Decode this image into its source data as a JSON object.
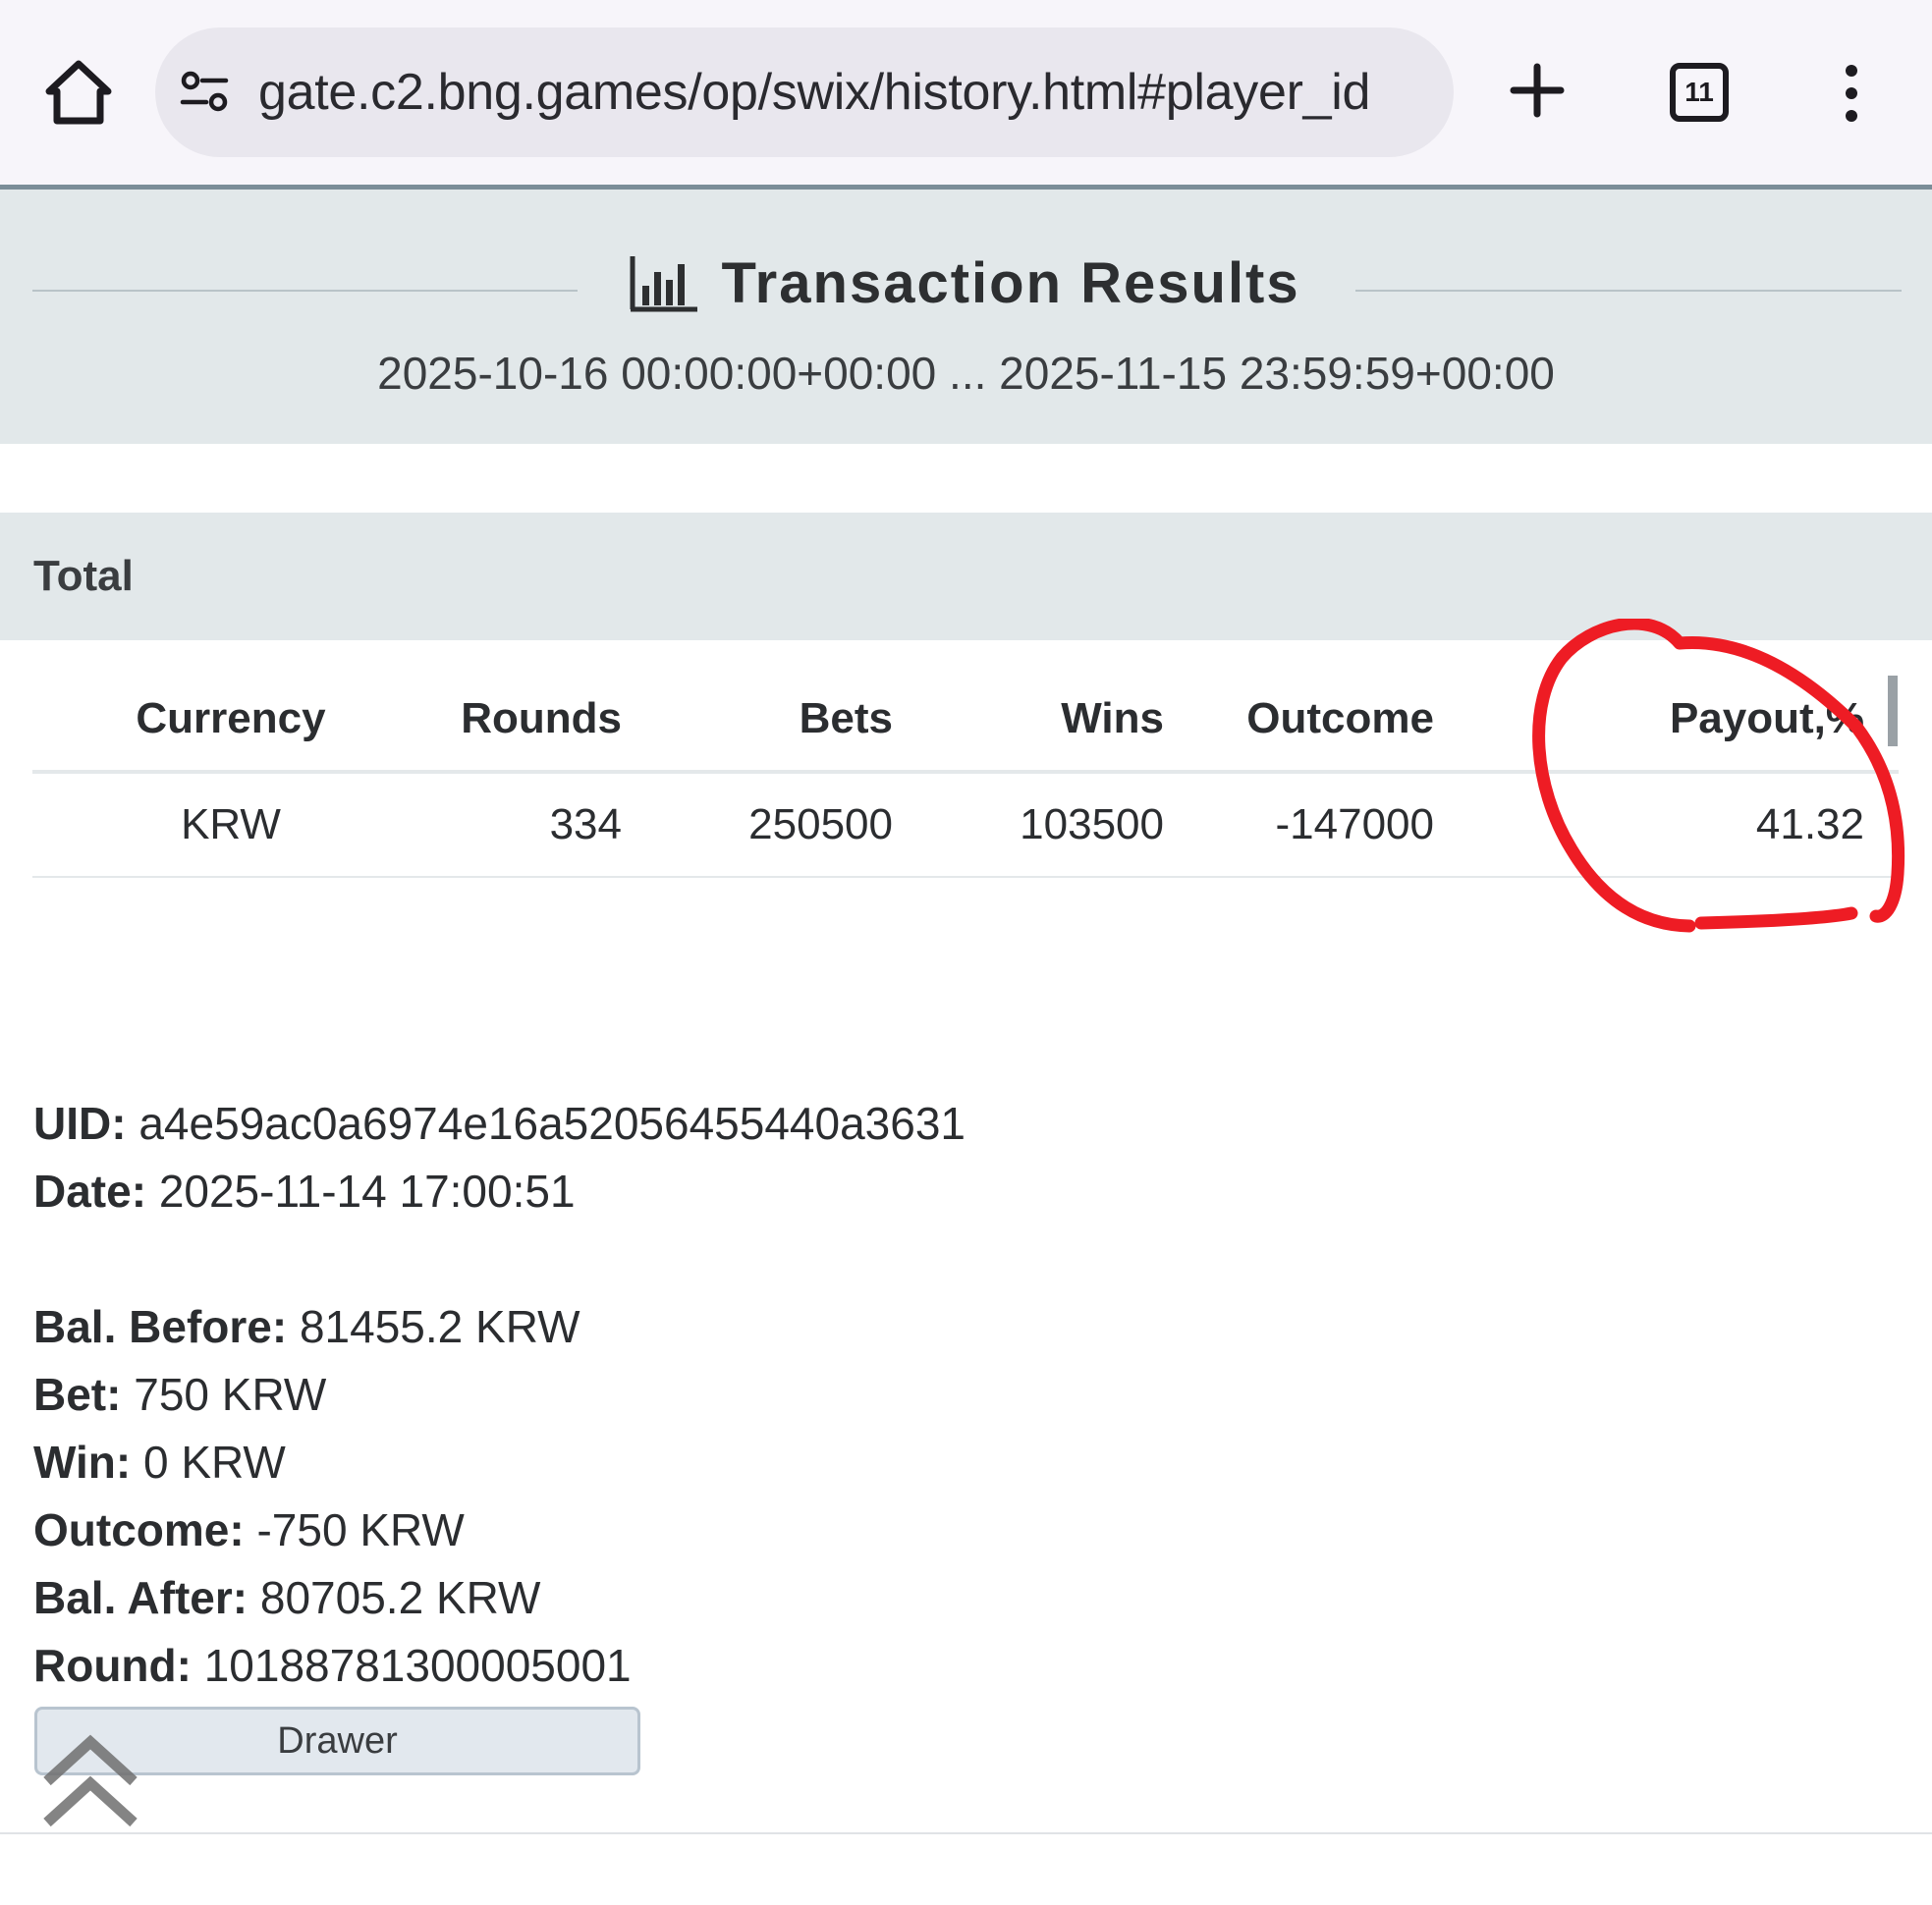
{
  "browser": {
    "url": "gate.c2.bng.games/op/swix/history.html#player_id",
    "tab_count": "11"
  },
  "header": {
    "title": "Transaction Results",
    "date_range": "2025-10-16 00:00:00+00:00 ... 2025-11-15 23:59:59+00:00"
  },
  "total": {
    "label": "Total",
    "columns": [
      "Currency",
      "Rounds",
      "Bets",
      "Wins",
      "Outcome",
      "Payout,%"
    ],
    "rows": [
      {
        "currency": "KRW",
        "rounds": "334",
        "bets": "250500",
        "wins": "103500",
        "outcome": "-147000",
        "payout": "41.32"
      }
    ]
  },
  "transaction": {
    "uid_label": "UID:",
    "uid": "a4e59ac0a6974e16a52056455440a3631",
    "date_label": "Date:",
    "date": "2025-11-14 17:00:51",
    "bal_before_label": "Bal. Before:",
    "bal_before": "81455.2 KRW",
    "bet_label": "Bet:",
    "bet": "750 KRW",
    "win_label": "Win:",
    "win": "0 KRW",
    "outcome_label": "Outcome:",
    "outcome": "-750 KRW",
    "bal_after_label": "Bal. After:",
    "bal_after": "80705.2 KRW",
    "round_label": "Round:",
    "round": "10188781300005001",
    "drawer_label": "Drawer"
  },
  "colors": {
    "header_band": "#e2e8ea",
    "annotation": "#ee1c24"
  },
  "icons": {
    "home": "home-icon",
    "site_settings": "site-settings-icon",
    "new_tab": "plus-icon",
    "tabs": "tabs-icon",
    "menu": "more-vert-icon",
    "title": "bar-chart-icon",
    "scroll_top": "double-chevron-up-icon"
  }
}
